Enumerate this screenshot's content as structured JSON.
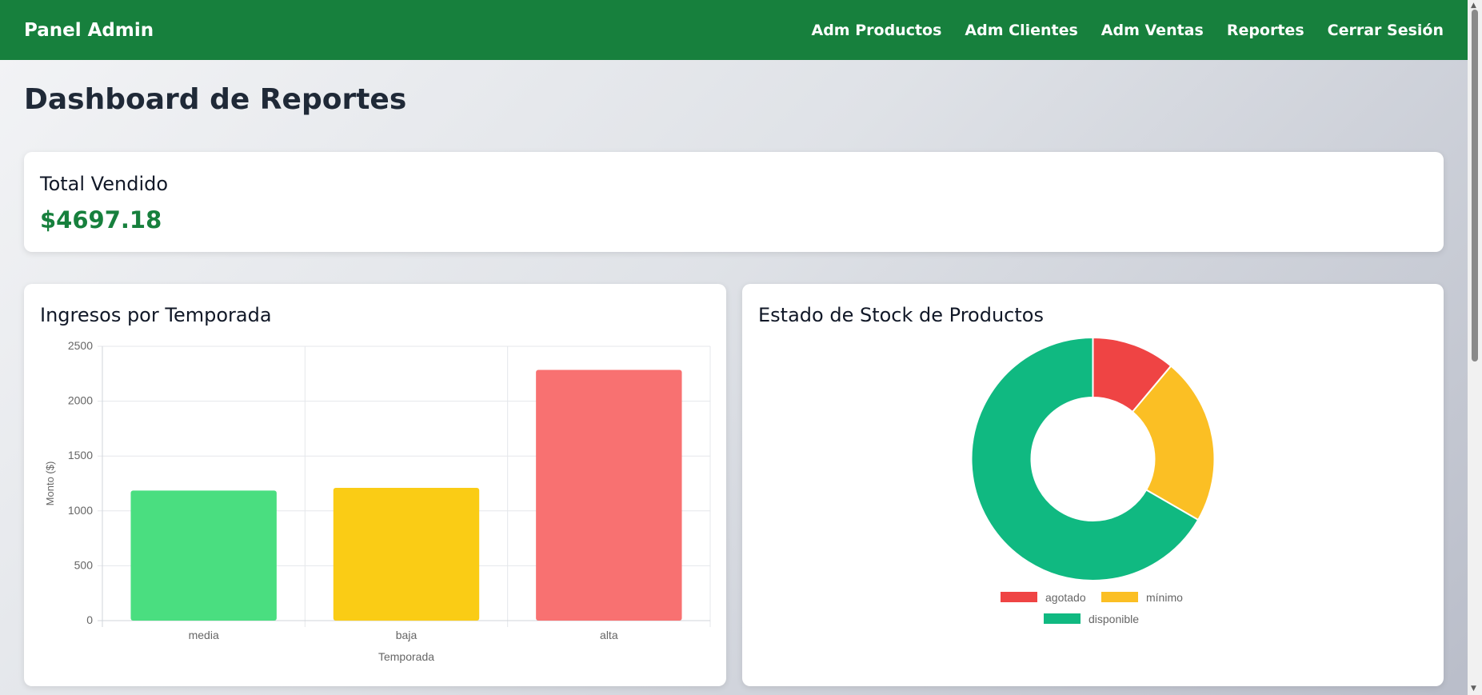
{
  "navbar": {
    "brand": "Panel Admin",
    "links": [
      "Adm Productos",
      "Adm Clientes",
      "Adm Ventas",
      "Reportes",
      "Cerrar Sesión"
    ],
    "background": "#17803d"
  },
  "page": {
    "title": "Dashboard de Reportes"
  },
  "total": {
    "label": "Total Vendido",
    "value": "$4697.18",
    "color": "#17803d"
  },
  "bar_card": {
    "title": "Ingresos por Temporada"
  },
  "pie_card": {
    "title": "Estado de Stock de Productos"
  },
  "chart_data": [
    {
      "type": "bar",
      "xlabel": "Temporada",
      "ylabel": "Monto ($)",
      "categories": [
        "media",
        "baja",
        "alta"
      ],
      "values": [
        1185,
        1210,
        2285
      ],
      "colors": [
        "#4ade80",
        "#facc15",
        "#f87171"
      ],
      "ylim": [
        0,
        2500
      ],
      "yticks": [
        0,
        500,
        1000,
        1500,
        2000,
        2500
      ],
      "grid": true
    },
    {
      "type": "pie",
      "variant": "doughnut",
      "labels": [
        "agotado",
        "mínimo",
        "disponible"
      ],
      "values": [
        1,
        2,
        6
      ],
      "colors": [
        "#ef4444",
        "#fbbf24",
        "#10b981"
      ],
      "legend": "bottom"
    }
  ]
}
